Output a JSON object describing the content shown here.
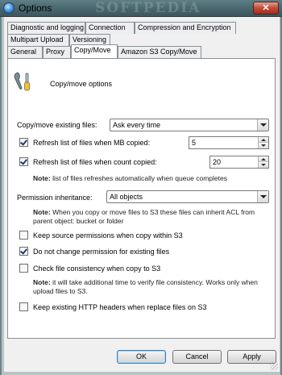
{
  "window": {
    "title": "Options",
    "watermark": "SOFTPEDIA",
    "close_glyph": "✕"
  },
  "tabs": {
    "row1": [
      "Diagnostic and logging",
      "Connection",
      "Compression and Encryption"
    ],
    "row2": [
      "Multipart Upload",
      "Versioning"
    ],
    "row3": [
      "General",
      "Proxy",
      "Copy/Move",
      "Amazon S3 Copy/Move"
    ],
    "selected": "Copy/Move"
  },
  "header": {
    "title": "Copy/move options",
    "icon": "wrench-screwdriver-icon"
  },
  "copy_move_existing": {
    "label": "Copy/move existing files:",
    "value": "Ask every time"
  },
  "refresh_mb": {
    "label": "Refresh list of files when MB copied:",
    "checked": true,
    "value": "5"
  },
  "refresh_count": {
    "label": "Refresh list of files when count copied:",
    "checked": true,
    "value": "20"
  },
  "note1": {
    "prefix": "Note:",
    "text": " list of files refreshes automatically when queue completes"
  },
  "permission_inheritance": {
    "label": "Permission inheritance:",
    "value": "All objects"
  },
  "note2": {
    "prefix": "Note:",
    "text": " When you copy or move files to S3 these files can inherit ACL from parent object: bucket or folder"
  },
  "options": [
    {
      "label": "Keep source permissions when copy within S3",
      "checked": false
    },
    {
      "label": "Do not change permission for existing files",
      "checked": true
    },
    {
      "label": "Check file consistency when copy to S3",
      "checked": false
    }
  ],
  "note3": {
    "prefix": "Note:",
    "text": " it will take additional time to verify file consistency. Works only when upload files to S3."
  },
  "keep_headers": {
    "label": "Keep existing HTTP headers when replace files on S3",
    "checked": false
  },
  "buttons": {
    "ok": "OK",
    "cancel": "Cancel",
    "apply": "Apply"
  },
  "colors": {
    "titlebar": "#4d6a72",
    "close": "#c44a34",
    "panel": "#ffffff",
    "dialog": "#f0f0f0"
  }
}
